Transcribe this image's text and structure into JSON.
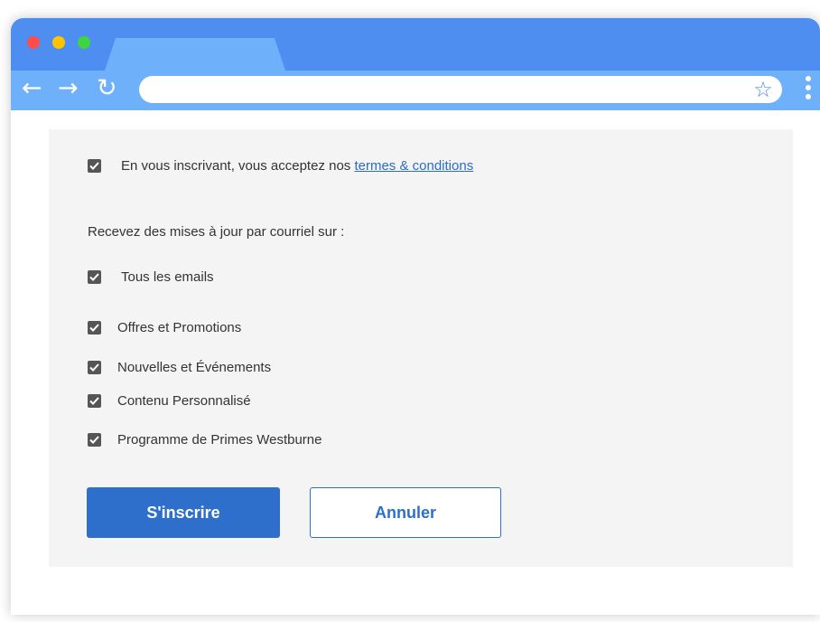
{
  "browser": {
    "nav": {
      "back_icon": "back-arrow-icon",
      "forward_icon": "forward-arrow-icon",
      "reload_icon": "reload-icon"
    },
    "url_value": "",
    "bookmark_icon": "star-icon",
    "menu_icon": "kebab-menu-icon",
    "colors": {
      "frame": "#4d8ef0",
      "toolbar": "#6fb0fb"
    }
  },
  "form": {
    "terms": {
      "checked": true,
      "text": "En vous inscrivant, vous acceptez nos ",
      "link": "termes & conditions"
    },
    "updates_heading": "Recevez des mises à jour par courriel sur :",
    "all_emails": {
      "checked": true,
      "label": "Tous les emails"
    },
    "options": [
      {
        "checked": true,
        "label": "Offres et Promotions"
      },
      {
        "checked": true,
        "label": "Nouvelles et Événements"
      },
      {
        "checked": true,
        "label": "Contenu Personnalisé"
      },
      {
        "checked": true,
        "label": "Programme de Primes Westburne"
      }
    ],
    "submit_label": "S'inscrire",
    "cancel_label": "Annuler",
    "colors": {
      "primary": "#2d6fcb",
      "panel": "#f4f4f4",
      "link": "#2a6cc7"
    }
  }
}
